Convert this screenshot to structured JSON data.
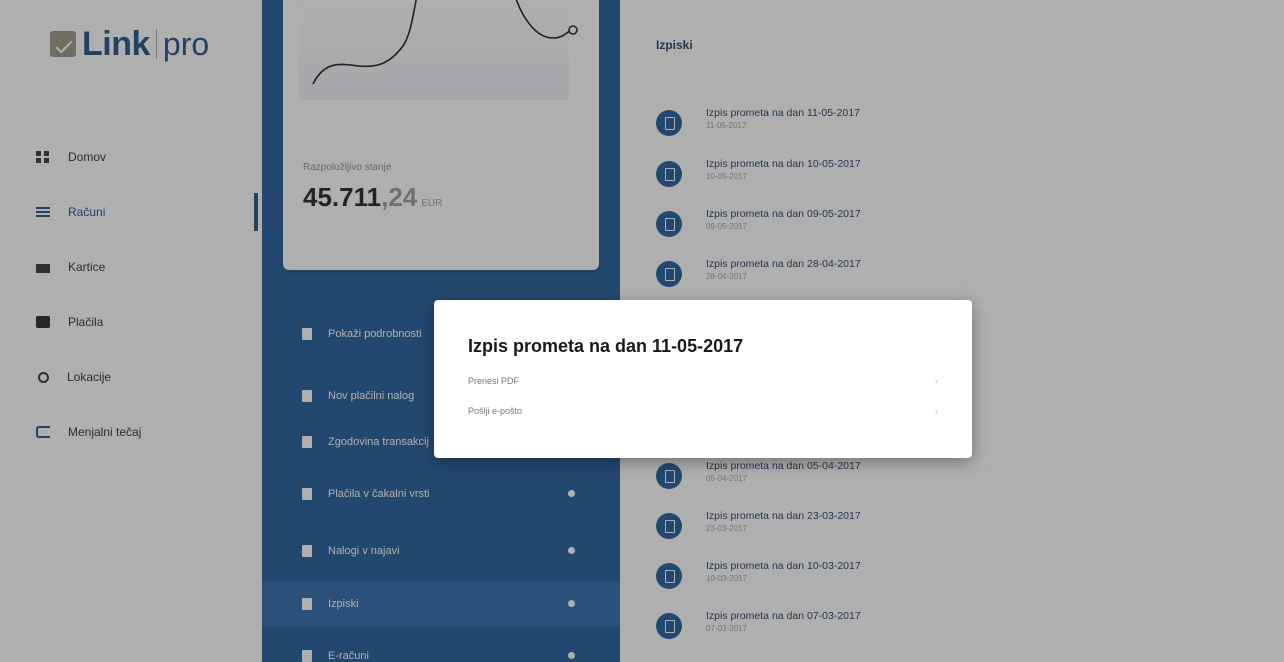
{
  "logo": {
    "brand": "Link",
    "suffix": "pro"
  },
  "nav": {
    "items": [
      {
        "label": "Domov",
        "icon": "grid-icon"
      },
      {
        "label": "Računi",
        "icon": "list-icon"
      },
      {
        "label": "Kartice",
        "icon": "card-icon"
      },
      {
        "label": "Plačila",
        "icon": "wallet-icon"
      },
      {
        "label": "Lokacije",
        "icon": "location-icon"
      },
      {
        "label": "Menjalni tečaj",
        "icon": "exchange-icon"
      }
    ],
    "active": "Računi"
  },
  "balance": {
    "label": "Razpoložljivo stanje",
    "whole": "45.711",
    "decimal": ",24",
    "currency": "EUR"
  },
  "menu": {
    "items": [
      {
        "label": "Pokaži podrobnosti"
      },
      {
        "label": "Nov plačilni nalog"
      },
      {
        "label": "Zgodovina transakcij"
      },
      {
        "label": "Plačila v čakalni vrsti"
      },
      {
        "label": "Nalogi v najavi"
      },
      {
        "label": "Izpiski"
      },
      {
        "label": "E-računi"
      }
    ]
  },
  "statements": {
    "title": "Izpiski",
    "items": [
      {
        "name": "Izpis prometa na dan 11-05-2017",
        "date": "11-05-2017"
      },
      {
        "name": "Izpis prometa na dan 10-05-2017",
        "date": "10-05-2017"
      },
      {
        "name": "Izpis prometa na dan 09-05-2017",
        "date": "09-05-2017"
      },
      {
        "name": "Izpis prometa na dan 28-04-2017",
        "date": "28-04-2017"
      },
      {
        "name": "Izpis prometa na dan 05-04-2017",
        "date": "05-04-2017"
      },
      {
        "name": "Izpis prometa na dan 23-03-2017",
        "date": "23-03-2017"
      },
      {
        "name": "Izpis prometa na dan 10-03-2017",
        "date": "10-03-2017"
      },
      {
        "name": "Izpis prometa na dan 07-03-2017",
        "date": "07-03-2017"
      }
    ]
  },
  "modal": {
    "title": "Izpis prometa na dan 11-05-2017",
    "options": [
      {
        "label": "Prenesi PDF",
        "arrow": "›"
      },
      {
        "label": "Pošlji e-pošto",
        "arrow": "›"
      }
    ]
  },
  "colors": {
    "brand_blue": "#1e5a9a",
    "accent_blue": "#1c4f87",
    "overlay": "#2d2d2d"
  }
}
